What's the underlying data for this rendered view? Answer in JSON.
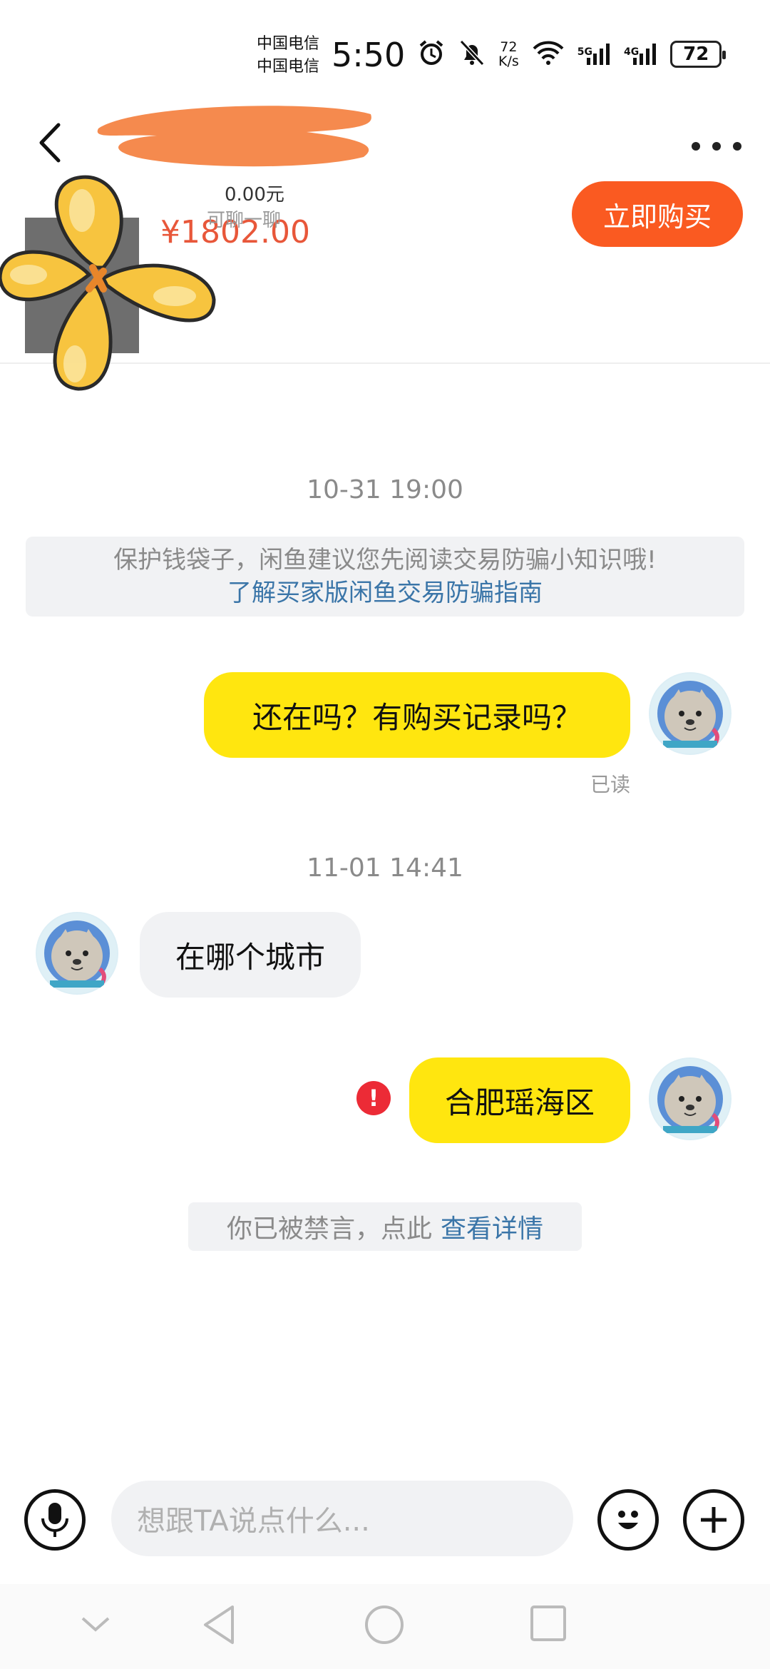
{
  "status_bar": {
    "carrier1": "中国电信",
    "carrier2": "中国电信",
    "time": "5:50",
    "net_speed_value": "72",
    "net_speed_unit": "K/s",
    "signal1_label": "5G",
    "signal2_label": "4G",
    "battery": "72"
  },
  "header": {
    "price": "¥1802.00",
    "sub_price": "0.00元",
    "chat_hint": "可聊一聊",
    "buy_button": "立即购买"
  },
  "chat": {
    "timestamp1": "10-31 19:00",
    "notice_line1": "保护钱袋子，闲鱼建议您先阅读交易防骗小知识哦!",
    "notice_link": "了解买家版闲鱼交易防骗指南",
    "messages": [
      {
        "sender": "me",
        "text": "还在吗？有购买记录吗？",
        "status": "已读"
      },
      {
        "sender": "them",
        "text": "在哪个城市"
      },
      {
        "sender": "me",
        "text": "合肥瑶海区",
        "failed": true
      }
    ],
    "timestamp2": "11-01 14:41",
    "error_mark": "!",
    "muted_text": "你已被禁言，点此",
    "muted_link": "查看详情"
  },
  "input_bar": {
    "placeholder": "想跟TA说点什么..."
  },
  "colors": {
    "accent_orange": "#fa5a21",
    "price_color": "#e8573a",
    "my_bubble": "#ffe60f",
    "link_blue": "#3a75a8",
    "error_red": "#ec2b36"
  }
}
